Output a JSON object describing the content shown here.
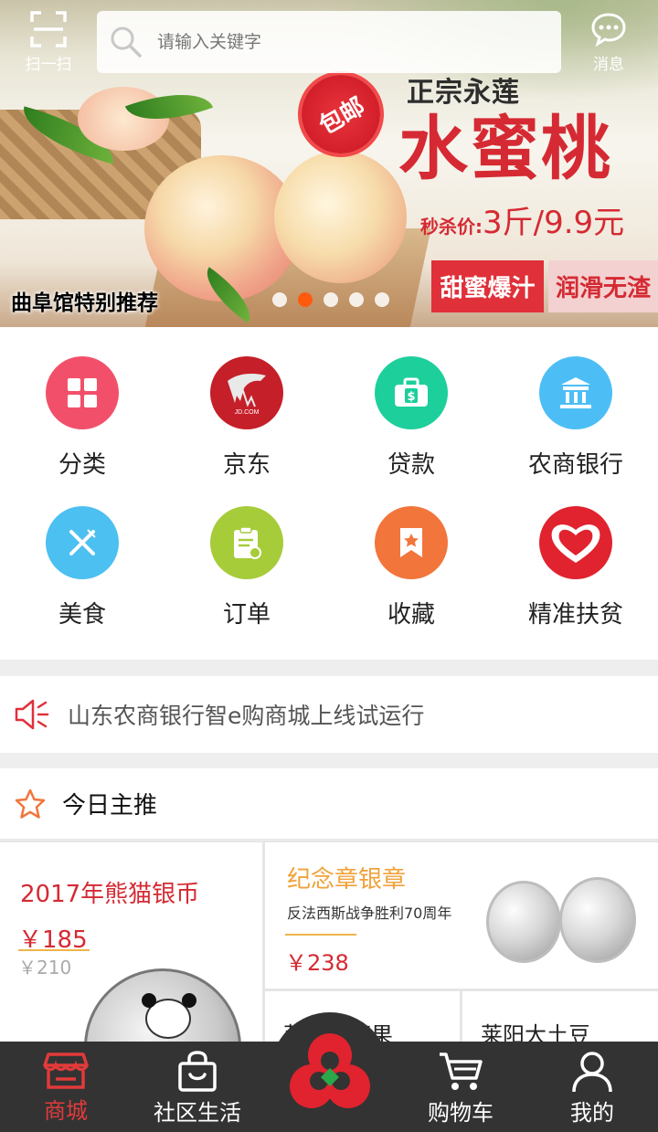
{
  "topbar": {
    "scan_label": "扫一扫",
    "search_placeholder": "请输入关键字",
    "message_label": "消息"
  },
  "banner": {
    "badge": "包邮",
    "subtitle": "正宗永莲",
    "title": "水蜜桃",
    "price_prefix": "秒杀价:",
    "price_value": "3斤/9.9元",
    "tag_left": "甜蜜爆汁",
    "tag_right": "润滑无渣",
    "recommend": "曲阜馆特别推荐",
    "slides": 5,
    "active_slide": 2
  },
  "grid": {
    "items": [
      {
        "label": "分类",
        "icon": "category-icon",
        "color": "#f2506a"
      },
      {
        "label": "京东",
        "icon": "jd-logo-icon",
        "color": "#c51f2a"
      },
      {
        "label": "贷款",
        "icon": "wallet-icon",
        "color": "#1dcf9b"
      },
      {
        "label": "农商银行",
        "icon": "bank-building-icon",
        "color": "#4dbef5"
      },
      {
        "label": "美食",
        "icon": "fork-knife-icon",
        "color": "#4cc0f0"
      },
      {
        "label": "订单",
        "icon": "clipboard-icon",
        "color": "#a6cc3a"
      },
      {
        "label": "收藏",
        "icon": "bookmark-star-icon",
        "color": "#f2753b"
      },
      {
        "label": "精准扶贫",
        "icon": "heart-icon",
        "color": "#e0232e"
      }
    ]
  },
  "notice": {
    "text": "山东农商银行智e购商城上线试运行"
  },
  "today": {
    "title": "今日主推"
  },
  "products": {
    "p1": {
      "title": "2017年熊猫银币",
      "price": "￥185",
      "old_price": "￥210"
    },
    "p2": {
      "title": "纪念章银章",
      "subtitle": "反法西斯战争胜利70周年",
      "price": "￥238"
    },
    "p3": {
      "title": "莱阳梨苹果"
    },
    "p4": {
      "title": "莱阳大土豆"
    }
  },
  "tabbar": {
    "tabs": [
      {
        "label": "商城",
        "active": true
      },
      {
        "label": "社区生活",
        "active": false
      },
      {
        "label": "购物车",
        "active": false
      },
      {
        "label": "我的",
        "active": false
      }
    ]
  },
  "colors": {
    "brand_red": "#e23a3a",
    "tabbar_bg": "#333333",
    "price_red": "#d52a33",
    "gold": "#f0a23a"
  }
}
